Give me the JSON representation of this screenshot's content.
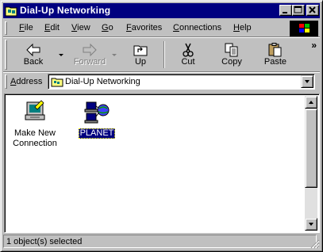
{
  "window": {
    "title": "Dial-Up Networking",
    "controls": {
      "minimize": "minimize",
      "maximize": "maximize",
      "close": "close"
    }
  },
  "menu": {
    "items": [
      {
        "u": "F",
        "rest": "ile"
      },
      {
        "u": "E",
        "rest": "dit"
      },
      {
        "u": "V",
        "rest": "iew"
      },
      {
        "u": "G",
        "rest": "o"
      },
      {
        "u": "F",
        "rest": "avorites"
      },
      {
        "u": "C",
        "rest": "onnections"
      },
      {
        "u": "H",
        "rest": "elp"
      }
    ]
  },
  "toolbar": {
    "back": "Back",
    "forward": "Forward",
    "up": "Up",
    "cut": "Cut",
    "copy": "Copy",
    "paste": "Paste",
    "more": "»"
  },
  "address": {
    "label_u": "A",
    "label_rest": "ddress",
    "value": "Dial-Up Networking"
  },
  "content": {
    "items": [
      {
        "label_line1": "Make New",
        "label_line2": "Connection",
        "icon": "make-new-connection-icon",
        "selected": false
      },
      {
        "label_line1": "PLANET",
        "label_line2": "",
        "icon": "network-connection-icon",
        "selected": true
      }
    ]
  },
  "status": {
    "text": "1 object(s) selected"
  },
  "colors": {
    "titlebar": "#000080",
    "face": "#c0c0c0",
    "selection": "#000080"
  }
}
